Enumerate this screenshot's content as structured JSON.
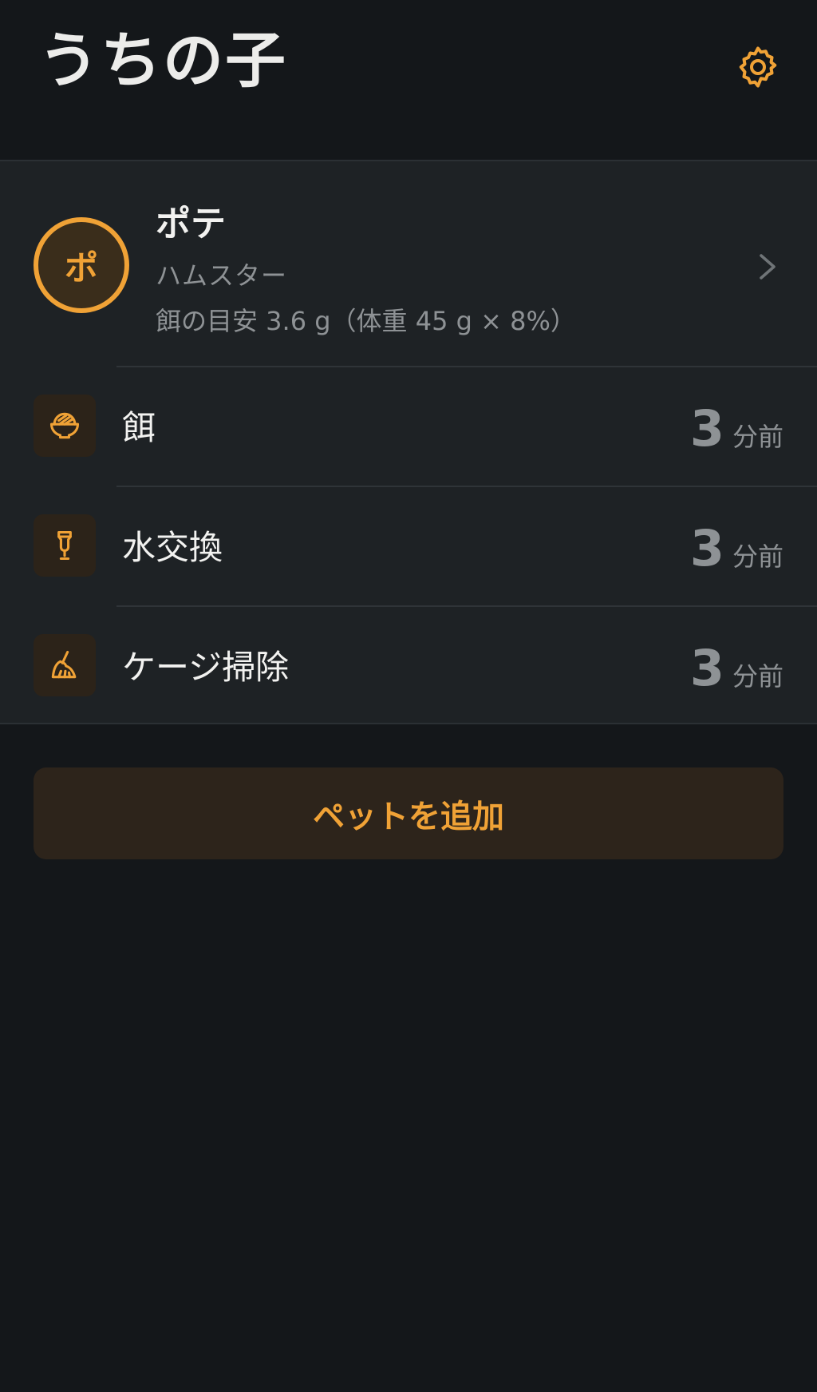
{
  "header": {
    "title": "うちの子",
    "settings_icon": "gear-icon"
  },
  "colors": {
    "accent": "#f0a236",
    "background": "#14171a",
    "card": "#1e2225",
    "muted_text": "#8e9295"
  },
  "pet": {
    "avatar_initial": "ポ",
    "name": "ポテ",
    "species": "ハムスター",
    "food_guide": "餌の目安 3.6 g（体重 45 g × 8%）"
  },
  "tasks": [
    {
      "icon": "rice-bowl-icon",
      "label": "餌",
      "value": "3",
      "unit": "分前"
    },
    {
      "icon": "water-bottle-icon",
      "label": "水交換",
      "value": "3",
      "unit": "分前"
    },
    {
      "icon": "broom-icon",
      "label": "ケージ掃除",
      "value": "3",
      "unit": "分前"
    }
  ],
  "add_button": {
    "label": "ペットを追加"
  }
}
